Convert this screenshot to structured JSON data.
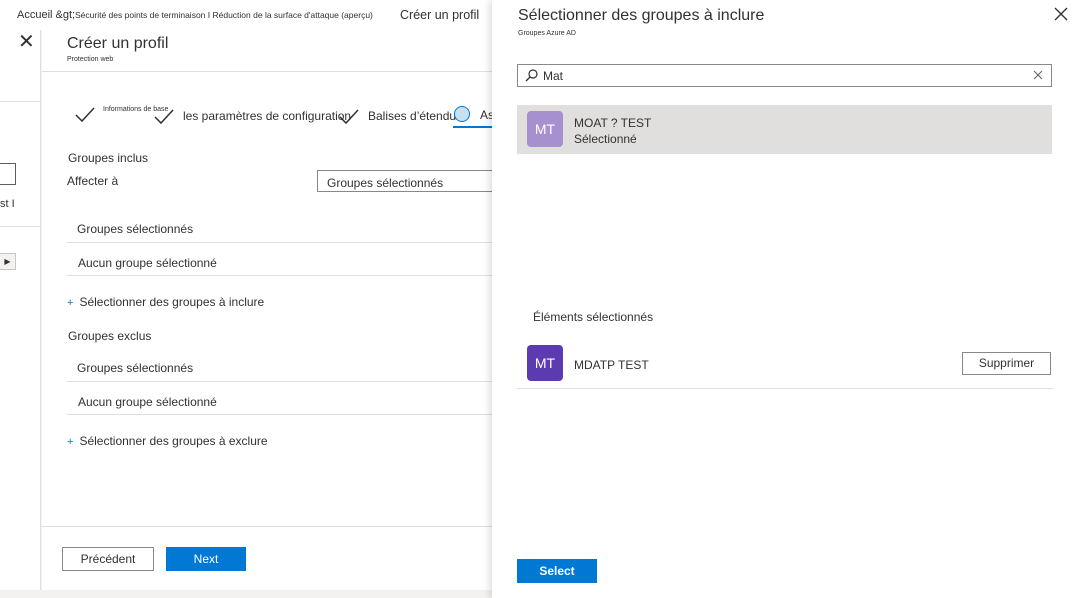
{
  "colors": {
    "accent": "#0078d4",
    "avatar_result": "#a790d0",
    "avatar_selected": "#5c3bb0"
  },
  "breadcrumb": {
    "home": "Accueil &gt;",
    "path": "Sécurité des points de terminaison I Réduction de la surface d'attaque (aperçu)",
    "current": "Créer un profil"
  },
  "left_strip": {
    "text": "st I"
  },
  "profile": {
    "title": "Créer un profil",
    "subtitle": "Protection web",
    "steps": {
      "basics_label": "Informations de base",
      "config_label": "les paramètres de configuration",
      "scope_label": "Balises d’étendue",
      "assign_label": "As"
    },
    "included_heading": "Groupes inclus",
    "assign_to_label": "Affecter à",
    "assign_to_value": "Groupes sélectionnés",
    "included_col_header": "Groupes sélectionnés",
    "included_empty": "Aucun groupe sélectionné",
    "include_link": "Sélectionner des groupes à inclure",
    "excluded_heading": "Groupes exclus",
    "excluded_col_header": "Groupes sélectionnés",
    "excluded_empty": "Aucun groupe sélectionné",
    "exclude_link": "Sélectionner des groupes à exclure",
    "prev_button": "Précédent",
    "next_button": "Next"
  },
  "overlay": {
    "title": "Sélectionner des groupes à inclure",
    "subtitle": "Groupes Azure AD",
    "search_value": "Mat",
    "result": {
      "initials": "MT",
      "name": "MOAT ? TEST",
      "status": "Sélectionné"
    },
    "selected_heading": "Éléments sélectionnés",
    "selected_item": {
      "initials": "MT",
      "name": "MDATP TEST",
      "remove_label": "Supprimer"
    },
    "select_button": "Select"
  }
}
